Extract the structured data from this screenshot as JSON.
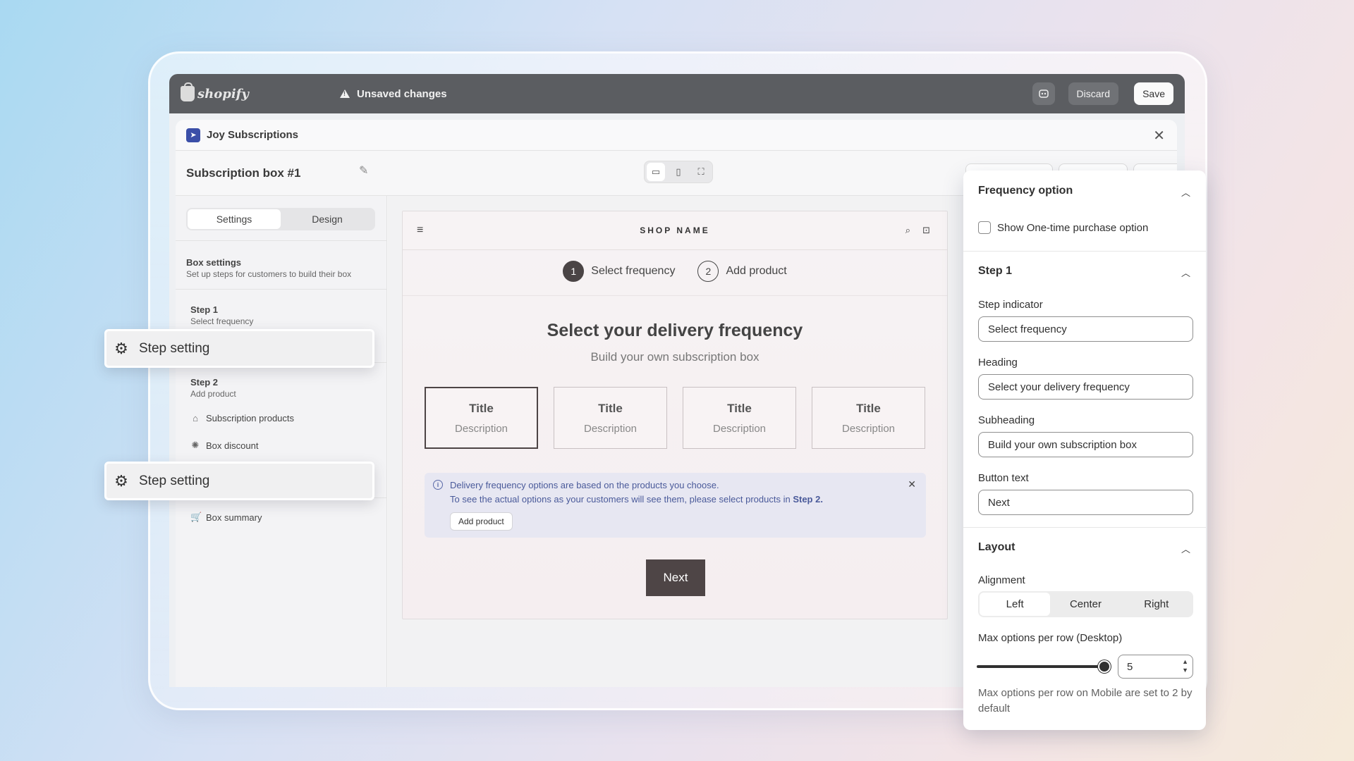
{
  "topbar": {
    "logo_text": "shopify",
    "unsaved": "Unsaved changes",
    "discard": "Discard",
    "save": "Save"
  },
  "app": {
    "name": "Joy Subscriptions",
    "box_title": "Subscription box #1"
  },
  "sidebar": {
    "tabs": [
      "Settings",
      "Design"
    ],
    "active_tab": "Settings",
    "box_settings_title": "Box settings",
    "box_settings_sub": "Set up steps for customers to build their box",
    "step1_title": "Step 1",
    "step1_sub": "Select frequency",
    "step2_title": "Step 2",
    "step2_sub": "Add product",
    "items": {
      "subscription_products": "Subscription products",
      "box_discount": "Box discount",
      "box_summary": "Box summary"
    }
  },
  "chips": {
    "step_setting_1": "Step setting",
    "step_setting_2": "Step setting"
  },
  "preview": {
    "shop_name": "SHOP NAME",
    "steps": [
      {
        "num": "1",
        "label": "Select frequency"
      },
      {
        "num": "2",
        "label": "Add product"
      }
    ],
    "heading": "Select your delivery frequency",
    "subheading": "Build your own subscription box",
    "options": [
      {
        "title": "Title",
        "desc": "Description"
      },
      {
        "title": "Title",
        "desc": "Description"
      },
      {
        "title": "Title",
        "desc": "Description"
      },
      {
        "title": "Title",
        "desc": "Description"
      }
    ],
    "notice_line1": "Delivery frequency options are based on the products you choose.",
    "notice_line2": "To see the actual options as your customers will see them, please select products in",
    "notice_step": "Step 2.",
    "add_product": "Add product",
    "next": "Next"
  },
  "panel": {
    "frequency_title": "Frequency option",
    "one_time_label": "Show One-time purchase option",
    "step1_title": "Step 1",
    "step_indicator_label": "Step indicator",
    "step_indicator_value": "Select frequency",
    "heading_label": "Heading",
    "heading_value": "Select your delivery frequency",
    "subheading_label": "Subheading",
    "subheading_value": "Build your own subscription box",
    "button_text_label": "Button text",
    "button_text_value": "Next",
    "layout_title": "Layout",
    "alignment_label": "Alignment",
    "alignment_options": [
      "Left",
      "Center",
      "Right"
    ],
    "alignment_selected": "Left",
    "max_label": "Max options per row (Desktop)",
    "max_value": "5",
    "slider_value": 5,
    "help": "Max options per row on Mobile are set to 2 by default"
  }
}
